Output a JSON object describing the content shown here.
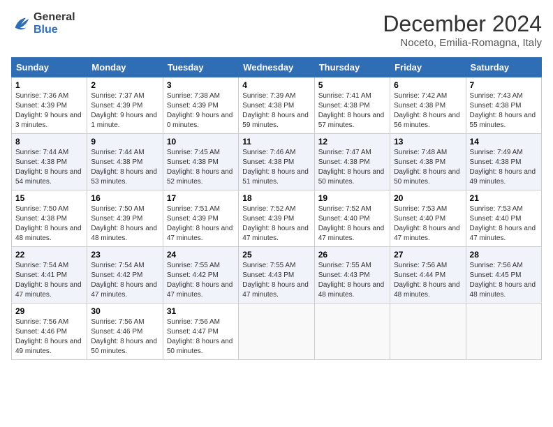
{
  "logo": {
    "line1": "General",
    "line2": "Blue"
  },
  "title": "December 2024",
  "subtitle": "Noceto, Emilia-Romagna, Italy",
  "days_of_week": [
    "Sunday",
    "Monday",
    "Tuesday",
    "Wednesday",
    "Thursday",
    "Friday",
    "Saturday"
  ],
  "weeks": [
    [
      {
        "day": "1",
        "sunrise": "7:36 AM",
        "sunset": "4:39 PM",
        "daylight": "9 hours and 3 minutes."
      },
      {
        "day": "2",
        "sunrise": "7:37 AM",
        "sunset": "4:39 PM",
        "daylight": "9 hours and 1 minute."
      },
      {
        "day": "3",
        "sunrise": "7:38 AM",
        "sunset": "4:39 PM",
        "daylight": "9 hours and 0 minutes."
      },
      {
        "day": "4",
        "sunrise": "7:39 AM",
        "sunset": "4:38 PM",
        "daylight": "8 hours and 59 minutes."
      },
      {
        "day": "5",
        "sunrise": "7:41 AM",
        "sunset": "4:38 PM",
        "daylight": "8 hours and 57 minutes."
      },
      {
        "day": "6",
        "sunrise": "7:42 AM",
        "sunset": "4:38 PM",
        "daylight": "8 hours and 56 minutes."
      },
      {
        "day": "7",
        "sunrise": "7:43 AM",
        "sunset": "4:38 PM",
        "daylight": "8 hours and 55 minutes."
      }
    ],
    [
      {
        "day": "8",
        "sunrise": "7:44 AM",
        "sunset": "4:38 PM",
        "daylight": "8 hours and 54 minutes."
      },
      {
        "day": "9",
        "sunrise": "7:44 AM",
        "sunset": "4:38 PM",
        "daylight": "8 hours and 53 minutes."
      },
      {
        "day": "10",
        "sunrise": "7:45 AM",
        "sunset": "4:38 PM",
        "daylight": "8 hours and 52 minutes."
      },
      {
        "day": "11",
        "sunrise": "7:46 AM",
        "sunset": "4:38 PM",
        "daylight": "8 hours and 51 minutes."
      },
      {
        "day": "12",
        "sunrise": "7:47 AM",
        "sunset": "4:38 PM",
        "daylight": "8 hours and 50 minutes."
      },
      {
        "day": "13",
        "sunrise": "7:48 AM",
        "sunset": "4:38 PM",
        "daylight": "8 hours and 50 minutes."
      },
      {
        "day": "14",
        "sunrise": "7:49 AM",
        "sunset": "4:38 PM",
        "daylight": "8 hours and 49 minutes."
      }
    ],
    [
      {
        "day": "15",
        "sunrise": "7:50 AM",
        "sunset": "4:38 PM",
        "daylight": "8 hours and 48 minutes."
      },
      {
        "day": "16",
        "sunrise": "7:50 AM",
        "sunset": "4:39 PM",
        "daylight": "8 hours and 48 minutes."
      },
      {
        "day": "17",
        "sunrise": "7:51 AM",
        "sunset": "4:39 PM",
        "daylight": "8 hours and 47 minutes."
      },
      {
        "day": "18",
        "sunrise": "7:52 AM",
        "sunset": "4:39 PM",
        "daylight": "8 hours and 47 minutes."
      },
      {
        "day": "19",
        "sunrise": "7:52 AM",
        "sunset": "4:40 PM",
        "daylight": "8 hours and 47 minutes."
      },
      {
        "day": "20",
        "sunrise": "7:53 AM",
        "sunset": "4:40 PM",
        "daylight": "8 hours and 47 minutes."
      },
      {
        "day": "21",
        "sunrise": "7:53 AM",
        "sunset": "4:40 PM",
        "daylight": "8 hours and 47 minutes."
      }
    ],
    [
      {
        "day": "22",
        "sunrise": "7:54 AM",
        "sunset": "4:41 PM",
        "daylight": "8 hours and 47 minutes."
      },
      {
        "day": "23",
        "sunrise": "7:54 AM",
        "sunset": "4:42 PM",
        "daylight": "8 hours and 47 minutes."
      },
      {
        "day": "24",
        "sunrise": "7:55 AM",
        "sunset": "4:42 PM",
        "daylight": "8 hours and 47 minutes."
      },
      {
        "day": "25",
        "sunrise": "7:55 AM",
        "sunset": "4:43 PM",
        "daylight": "8 hours and 47 minutes."
      },
      {
        "day": "26",
        "sunrise": "7:55 AM",
        "sunset": "4:43 PM",
        "daylight": "8 hours and 48 minutes."
      },
      {
        "day": "27",
        "sunrise": "7:56 AM",
        "sunset": "4:44 PM",
        "daylight": "8 hours and 48 minutes."
      },
      {
        "day": "28",
        "sunrise": "7:56 AM",
        "sunset": "4:45 PM",
        "daylight": "8 hours and 48 minutes."
      }
    ],
    [
      {
        "day": "29",
        "sunrise": "7:56 AM",
        "sunset": "4:46 PM",
        "daylight": "8 hours and 49 minutes."
      },
      {
        "day": "30",
        "sunrise": "7:56 AM",
        "sunset": "4:46 PM",
        "daylight": "8 hours and 50 minutes."
      },
      {
        "day": "31",
        "sunrise": "7:56 AM",
        "sunset": "4:47 PM",
        "daylight": "8 hours and 50 minutes."
      },
      null,
      null,
      null,
      null
    ]
  ]
}
